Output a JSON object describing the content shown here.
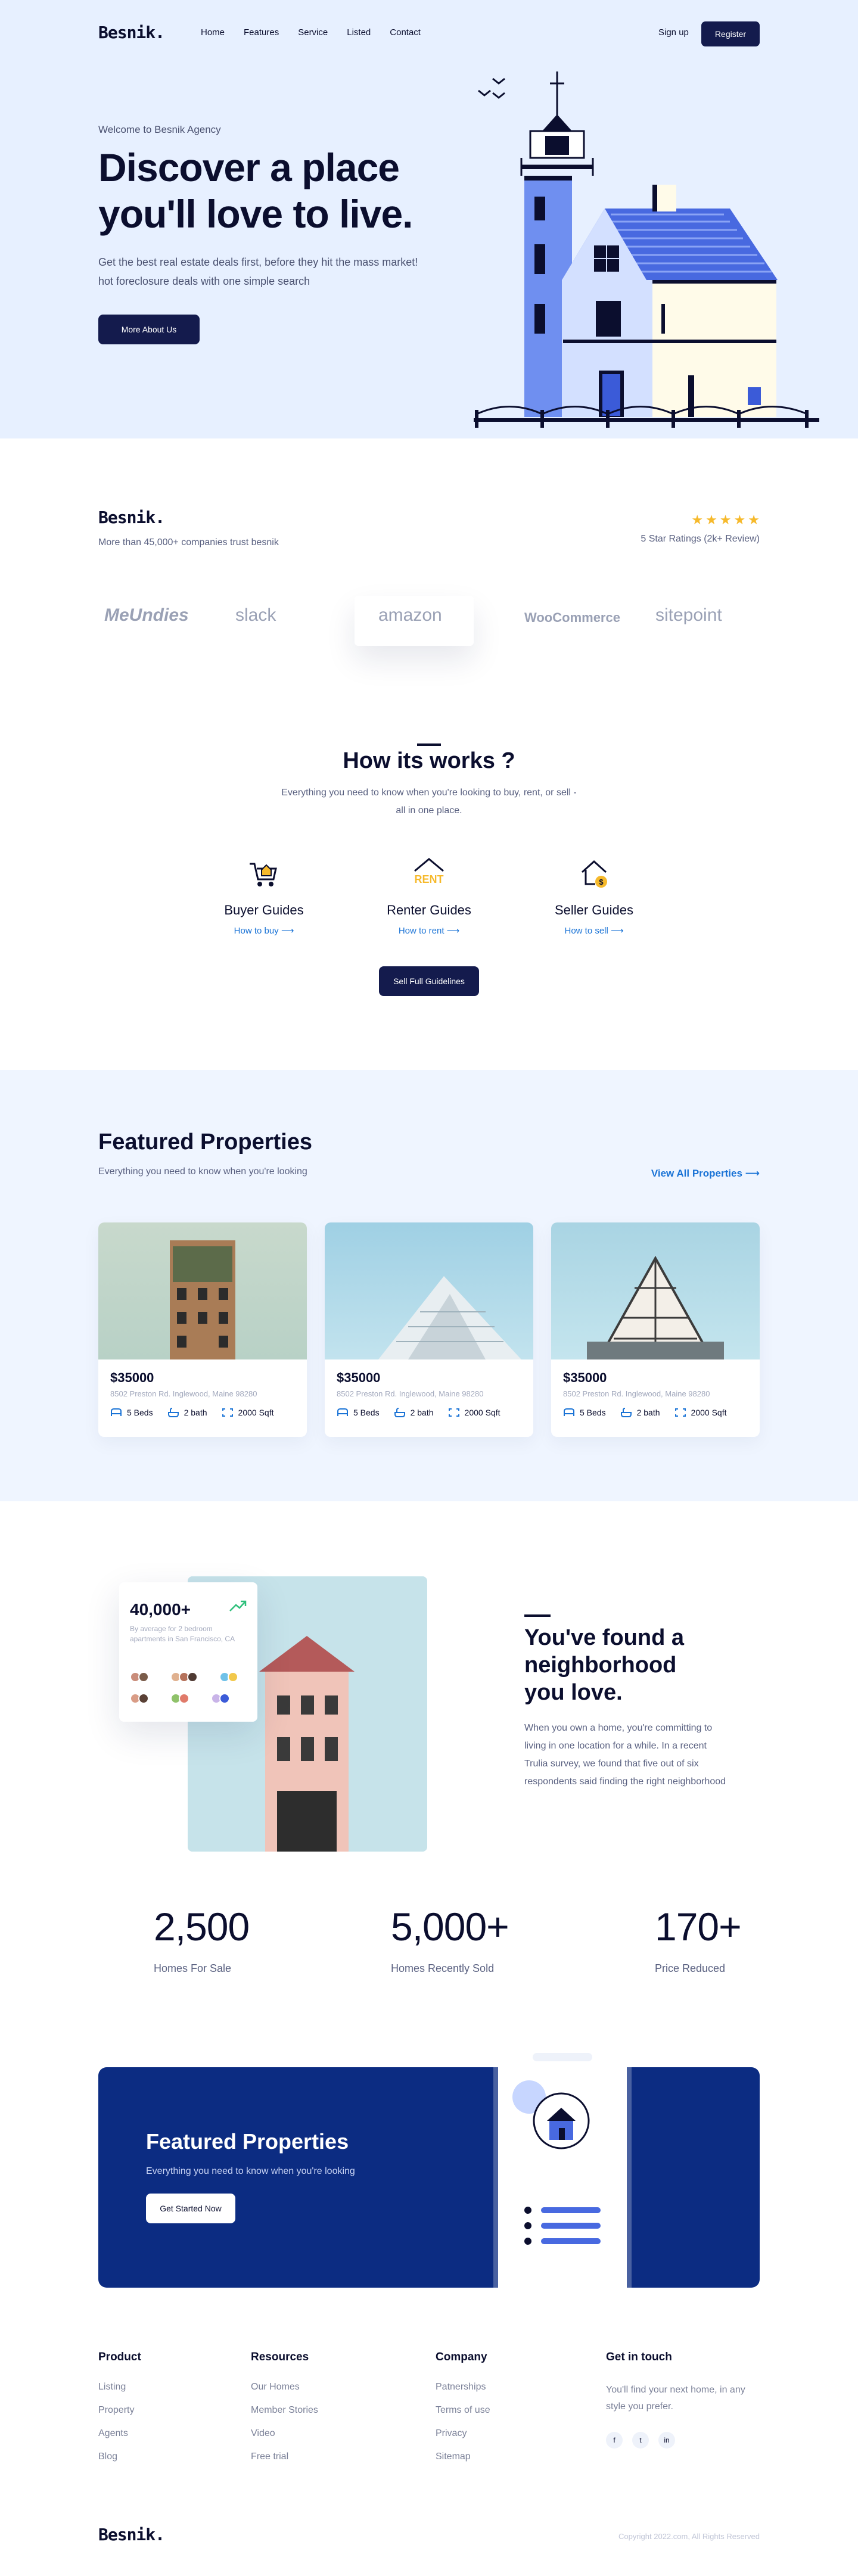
{
  "nav": {
    "logo": "Besnik.",
    "links": [
      "Home",
      "Features",
      "Service",
      "Listed",
      "Contact"
    ],
    "signup": "Sign up",
    "register": "Register"
  },
  "hero": {
    "welcome": "Welcome to Besnik Agency",
    "title": "Discover a place you'll love to live.",
    "subtitle": "Get the best real estate deals first, before they hit the mass market! hot foreclosure deals with one simple search",
    "button": "More About Us"
  },
  "trust": {
    "logo": "Besnik.",
    "text": "More than 45,000+ companies trust besnik",
    "rating_text": "5 Star Ratings (2k+ Review)",
    "stars": 5,
    "brands": [
      "MeUndies",
      "slack",
      "amazon",
      "WooCommerce",
      "sitepoint"
    ]
  },
  "how": {
    "title": "How its works ?",
    "subtitle": "Everything you need to know when you're looking to buy, rent, or sell - all in one place.",
    "guides": [
      {
        "title": "Buyer Guides",
        "link": "How to buy ⟶",
        "icon": "cart-house-icon"
      },
      {
        "title": "Renter Guides",
        "link": "How to rent ⟶",
        "icon": "rent-icon"
      },
      {
        "title": "Seller Guides",
        "link": "How to sell ⟶",
        "icon": "sell-house-icon"
      }
    ],
    "rent_sign": "RENT",
    "button": "Sell Full Guidelines"
  },
  "featured": {
    "title": "Featured Properties",
    "subtitle": "Everything you need to know when you're looking",
    "view_all": "View All Properties ⟶",
    "cards": [
      {
        "price": "$35000",
        "address": "8502 Preston Rd. Inglewood, Maine 98280",
        "beds": "5 Beds",
        "bath": "2 bath",
        "area": "2000 Sqft"
      },
      {
        "price": "$35000",
        "address": "8502 Preston Rd. Inglewood, Maine 98280",
        "beds": "5 Beds",
        "bath": "2 bath",
        "area": "2000 Sqft"
      },
      {
        "price": "$35000",
        "address": "8502 Preston Rd. Inglewood, Maine 98280",
        "beds": "5 Beds",
        "bath": "2 bath",
        "area": "2000 Sqft"
      }
    ]
  },
  "neighborhood": {
    "card_number": "40,000+",
    "card_desc": "By average for 2 bedroom apartments in San Francisco, CA",
    "title": "You've found a neighborhood you love.",
    "text": "When you own a home, you're committing to living in one location for a while. In a recent Trulia survey, we found that five out of six respondents said finding the right neighborhood"
  },
  "stats": [
    {
      "value": "2,500",
      "label": "Homes For Sale"
    },
    {
      "value": "5,000+",
      "label": "Homes Recently Sold"
    },
    {
      "value": "170+",
      "label": "Price Reduced"
    }
  ],
  "cta": {
    "title": "Featured Properties",
    "subtitle": "Everything you need to know when you're looking",
    "button": "Get Started Now"
  },
  "footer": {
    "product": {
      "title": "Product",
      "items": [
        "Listing",
        "Property",
        "Agents",
        "Blog"
      ]
    },
    "resources": {
      "title": "Resources",
      "items": [
        "Our Homes",
        "Member Stories",
        "Video",
        "Free trial"
      ]
    },
    "company": {
      "title": "Company",
      "items": [
        "Patnerships",
        "Terms of use",
        "Privacy",
        "Sitemap"
      ]
    },
    "contact": {
      "title": "Get in touch",
      "text": "You'll find your next home, in any style you prefer.",
      "socials": [
        "f",
        "t",
        "in"
      ]
    },
    "logo": "Besnik.",
    "copyright": "Copyright 2022.com, All Rights Reserved"
  },
  "colors": {
    "primary": "#141b4d",
    "accent": "#1a73d6",
    "hero_bg": "#e7f0ff",
    "cta_bg": "#0c2c82",
    "star": "#f6b92b"
  }
}
